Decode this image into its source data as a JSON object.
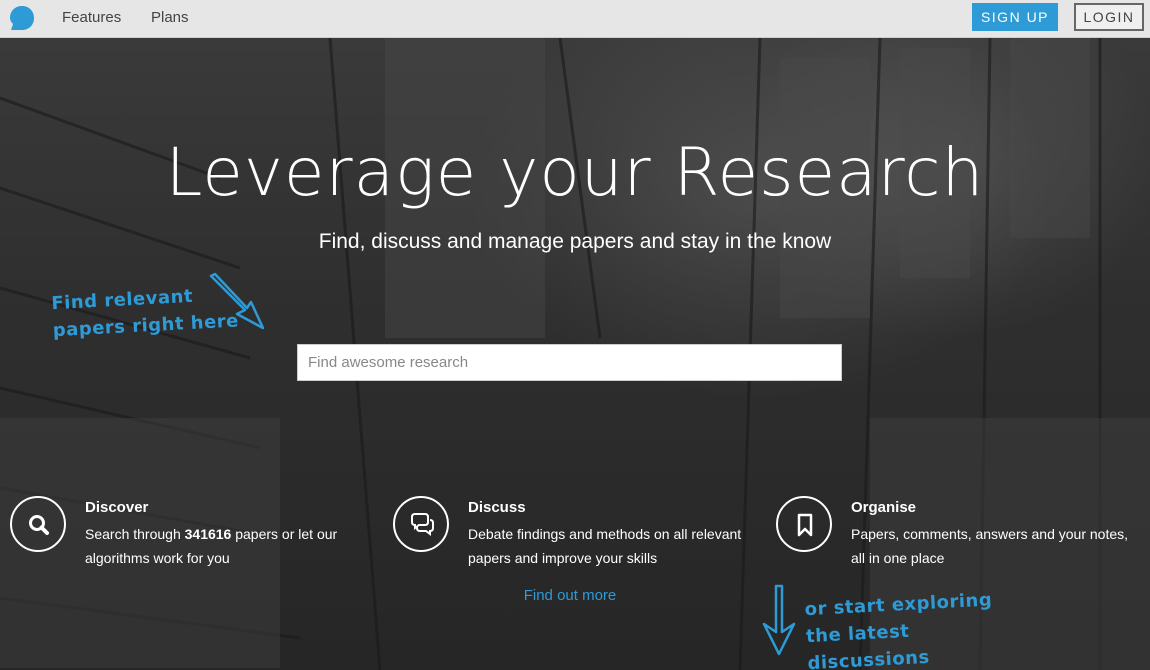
{
  "nav": {
    "features": "Features",
    "plans": "Plans",
    "signup": "SIGN UP",
    "login": "LOGIN"
  },
  "hero": {
    "title": "Leverage your Research",
    "subtitle": "Find, discuss and manage papers and stay in the know",
    "search_placeholder": "Find awesome research",
    "hint_left_line1": "Find relevant",
    "hint_left_line2": "papers right here",
    "hint_right_line1": "or start exploring",
    "hint_right_line2": "the latest discussions"
  },
  "features": [
    {
      "icon": "search-icon",
      "title": "Discover",
      "desc_before": "Search through ",
      "count": "341616",
      "desc_after": " papers or let our algorithms work for you"
    },
    {
      "icon": "chat-icon",
      "title": "Discuss",
      "desc": "Debate findings and methods on all relevant papers and improve your skills"
    },
    {
      "icon": "bookmark-icon",
      "title": "Organise",
      "desc": "Papers, comments, answers and your notes, all in one place"
    }
  ],
  "find_more": "Find out more",
  "colors": {
    "accent": "#2e9ad6",
    "nav_bg": "#e6e6e6"
  }
}
